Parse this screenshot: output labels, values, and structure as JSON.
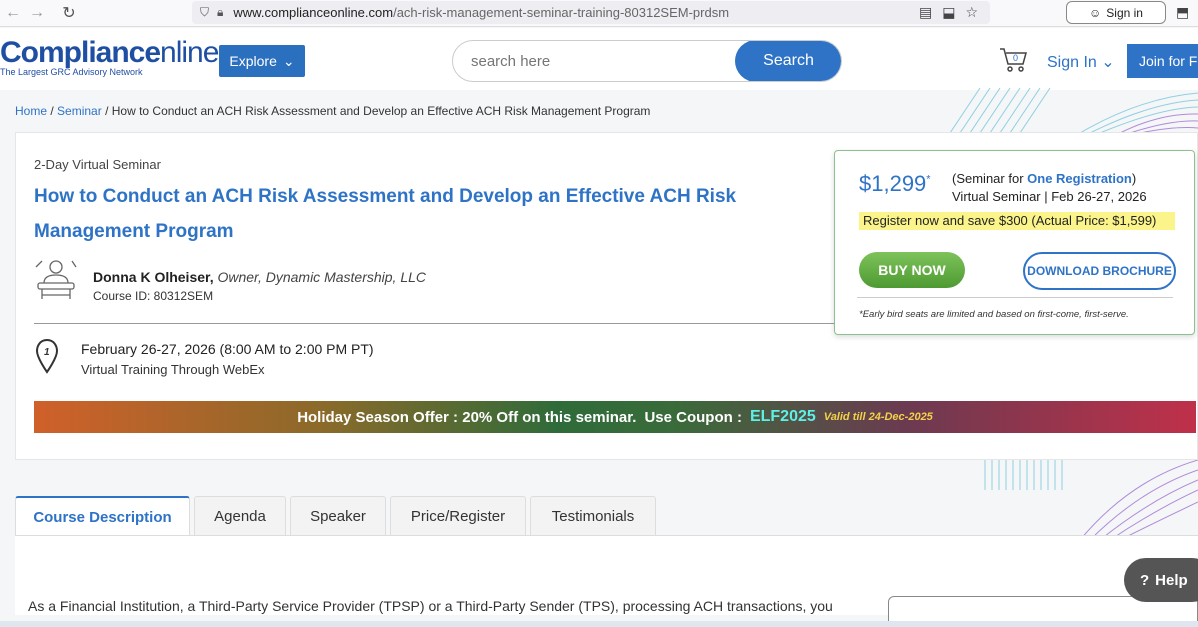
{
  "browser": {
    "url_domain": "www.complianceonline.com",
    "url_path": "/ach-risk-management-seminar-training-80312SEM-prdsm",
    "signin_label": "Sign in"
  },
  "header": {
    "logo_bold": "Compliance",
    "logo_light": "nline",
    "logo_tagline": "The Largest GRC Advisory Network",
    "explore_label": "Explore",
    "search_placeholder": "search here",
    "search_button": "Search",
    "cart_count": "0",
    "signin_label": "Sign In",
    "join_label": "Join for Fr"
  },
  "breadcrumb": {
    "home": "Home",
    "seminar": "Seminar",
    "current": "How to Conduct an ACH Risk Assessment and Develop an Effective ACH Risk Management Program"
  },
  "course": {
    "type": "2-Day Virtual Seminar",
    "title": "How to Conduct an ACH Risk Assessment and Develop an Effective ACH Risk Management Program",
    "speaker_name": "Donna K Olheiser,",
    "speaker_role": "Owner, Dynamic Mastership, LLC",
    "course_id": "Course ID: 80312SEM",
    "date": "February 26-27, 2026 (8:00 AM to 2:00 PM PT)",
    "venue": "Virtual Training Through WebEx",
    "date_badge": "1"
  },
  "offer": {
    "text": "Holiday Season Offer : 20% Off on this seminar.",
    "coupon_label": "Use Coupon :",
    "coupon_code": "ELF2025",
    "valid": "Valid till 24-Dec-2025"
  },
  "pricing": {
    "price": "$1,299",
    "price_mark": "*",
    "reg_prefix": "(Seminar for ",
    "reg_type": "One Registration",
    "reg_suffix": ")",
    "reg_date": "Virtual Seminar | Feb 26-27, 2026",
    "save_note": "Register now and save $300 (Actual Price: $1,599)",
    "buy_label": "BUY NOW",
    "brochure_label": "DOWNLOAD BROCHURE",
    "early_note": "*Early bird seats are limited and based on first-come, first-serve."
  },
  "tabs": [
    {
      "label": "Course Description",
      "active": true
    },
    {
      "label": "Agenda",
      "active": false
    },
    {
      "label": "Speaker",
      "active": false
    },
    {
      "label": "Price/Register",
      "active": false
    },
    {
      "label": "Testimonials",
      "active": false
    }
  ],
  "content": {
    "description": "As a Financial Institution, a Third-Party Service Provider (TPSP) or a Third-Party Sender (TPS), processing ACH transactions, you"
  },
  "help": {
    "label": "Help"
  },
  "colors": {
    "brand_blue": "#2e73c6",
    "buy_green": "#4e9a32",
    "highlight_yellow": "#fbf48a",
    "coupon_cyan": "#5cf0e6"
  }
}
